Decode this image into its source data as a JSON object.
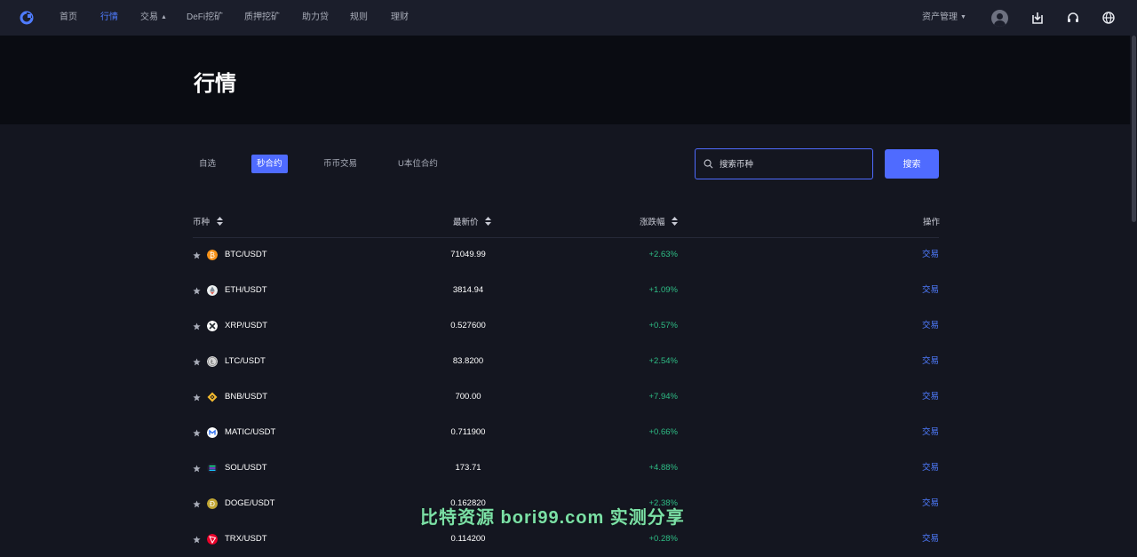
{
  "nav": {
    "items": [
      {
        "label": "首页",
        "active": false
      },
      {
        "label": "行情",
        "active": true
      },
      {
        "label": "交易",
        "active": false,
        "dropdown": true
      },
      {
        "label": "DeFi挖矿",
        "active": false
      },
      {
        "label": "质押挖矿",
        "active": false
      },
      {
        "label": "助力贷",
        "active": false
      },
      {
        "label": "规则",
        "active": false
      },
      {
        "label": "理财",
        "active": false
      }
    ],
    "asset_menu": "资产管理",
    "icons": [
      "user-avatar-icon",
      "download-icon",
      "headset-icon",
      "globe-icon"
    ]
  },
  "hero": {
    "title": "行情"
  },
  "tabs": [
    {
      "label": "自选",
      "active": false
    },
    {
      "label": "秒合约",
      "active": true
    },
    {
      "label": "币币交易",
      "active": false
    },
    {
      "label": "U本位合约",
      "active": false
    }
  ],
  "search": {
    "placeholder": "搜索币种",
    "button": "搜索"
  },
  "table": {
    "headers": {
      "coin": "币种",
      "price": "最新价",
      "change": "涨跌幅",
      "action": "操作"
    },
    "rows": [
      {
        "pair": "BTC/USDT",
        "price": "71049.99",
        "change": "+2.63%",
        "action": "交易",
        "icon": "btc-icon",
        "color": "#f7931a"
      },
      {
        "pair": "ETH/USDT",
        "price": "3814.94",
        "change": "+1.09%",
        "action": "交易",
        "icon": "eth-icon",
        "color": "#ecf0f1"
      },
      {
        "pair": "XRP/USDT",
        "price": "0.527600",
        "change": "+0.57%",
        "action": "交易",
        "icon": "xrp-icon",
        "color": "#ffffff"
      },
      {
        "pair": "LTC/USDT",
        "price": "83.8200",
        "change": "+2.54%",
        "action": "交易",
        "icon": "ltc-icon",
        "color": "#d8d8d8"
      },
      {
        "pair": "BNB/USDT",
        "price": "700.00",
        "change": "+7.94%",
        "action": "交易",
        "icon": "bnb-icon",
        "color": "#f3ba2f"
      },
      {
        "pair": "MATIC/USDT",
        "price": "0.711900",
        "change": "+0.66%",
        "action": "交易",
        "icon": "matic-icon",
        "color": "#ffffff"
      },
      {
        "pair": "SOL/USDT",
        "price": "173.71",
        "change": "+4.88%",
        "action": "交易",
        "icon": "sol-icon",
        "color": "#9945ff"
      },
      {
        "pair": "DOGE/USDT",
        "price": "0.162820",
        "change": "+2.38%",
        "action": "交易",
        "icon": "doge-icon",
        "color": "#c2a633"
      },
      {
        "pair": "TRX/USDT",
        "price": "0.114200",
        "change": "+0.28%",
        "action": "交易",
        "icon": "trx-icon",
        "color": "#eb0029"
      }
    ]
  },
  "watermark": "比特资源 bori99.com 实测分享",
  "colors": {
    "accent": "#4f6bff",
    "up": "#2ebd85",
    "link": "#4f7cff"
  }
}
